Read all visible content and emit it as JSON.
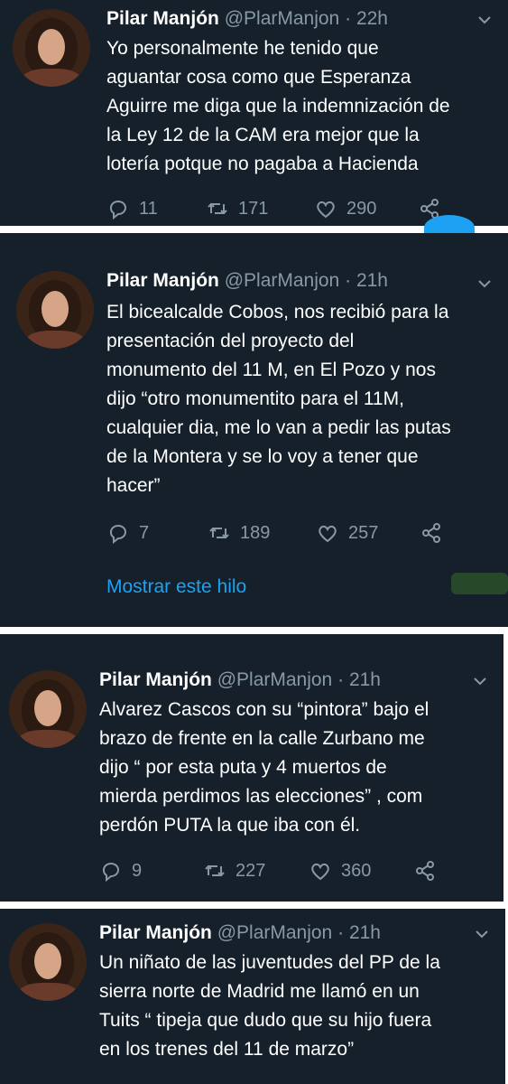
{
  "tweets": [
    {
      "name": "Pilar Manjón",
      "handle": "@PlarManjon",
      "dot": "·",
      "time": "22h",
      "text": "Yo personalmente he tenido que\naguantar cosa como que Esperanza\nAguirre me diga que la indemnización de\nla Ley 12 de la CAM era mejor que la\nlotería potque no pagaba a Hacienda",
      "replies": "11",
      "retweets": "171",
      "likes": "290"
    },
    {
      "name": "Pilar Manjón",
      "handle": "@PlarManjon",
      "dot": "·",
      "time": "21h",
      "text": "El bicealcalde Cobos, nos recibió para la\npresentación del proyecto del\nmonumento del 11 M, en El Pozo y nos\ndijo “otro monumentito para el 11M,\ncualquier dia, me lo van a pedir las putas\nde la Montera y se lo voy a tener que\nhacer”",
      "replies": "7",
      "retweets": "189",
      "likes": "257",
      "thread_link": "Mostrar este hilo"
    },
    {
      "name": "Pilar Manjón",
      "handle": "@PlarManjon",
      "dot": "·",
      "time": "21h",
      "text": "Alvarez Cascos con su “pintora” bajo el\nbrazo de frente en la calle Zurbano me\ndijo “ por esta puta y 4 muertos de\nmierda perdimos las elecciones” , com\nperdón PUTA  la que iba con él.",
      "replies": "9",
      "retweets": "227",
      "likes": "360"
    },
    {
      "name": "Pilar Manjón",
      "handle": "@PlarManjon",
      "dot": "·",
      "time": "21h",
      "text": "Un niñato de las juventudes del PP de la\nsierra norte de Madrid me llamó en un\nTuits “ tipeja que dudo que su hijo fuera\nen los trenes del 11 de marzo”"
    }
  ],
  "icons": {
    "reply": "reply-icon",
    "retweet": "retweet-icon",
    "like": "heart-icon",
    "share": "share-icon",
    "menu": "chevron-down-icon"
  },
  "colors": {
    "background": "#15202b",
    "secondary_text": "#8899a6",
    "link": "#1da1f2"
  }
}
